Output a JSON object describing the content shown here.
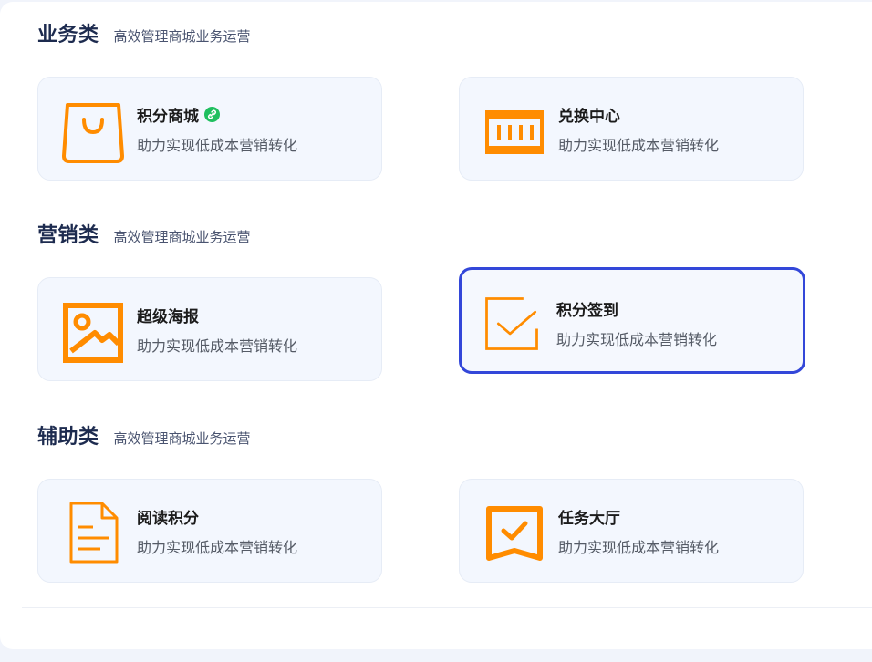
{
  "sections": [
    {
      "name": "业务类",
      "subtitle": "高效管理商城业务运营",
      "cards": [
        {
          "title": "积分商城",
          "desc": "助力实现低成本营销转化",
          "icon": "shopping-bag-icon",
          "badge": "link-icon"
        },
        {
          "title": "兑换中心",
          "desc": "助力实现低成本营销转化",
          "icon": "barcode-icon"
        }
      ]
    },
    {
      "name": "营销类",
      "subtitle": "高效管理商城业务运营",
      "cards": [
        {
          "title": "超级海报",
          "desc": "助力实现低成本营销转化",
          "icon": "image-icon"
        },
        {
          "title": "积分签到",
          "desc": "助力实现低成本营销转化",
          "icon": "checkbox-icon",
          "selected": true
        }
      ]
    },
    {
      "name": "辅助类",
      "subtitle": "高效管理商城业务运营",
      "cards": [
        {
          "title": "阅读积分",
          "desc": "助力实现低成本营销转化",
          "icon": "document-icon"
        },
        {
          "title": "任务大厅",
          "desc": "助力实现低成本营销转化",
          "icon": "task-banner-icon"
        }
      ]
    }
  ],
  "colors": {
    "icon_orange": "#ff8c00",
    "selected_border": "#3347d9",
    "badge_green": "#1fbf5f",
    "card_bg": "#f3f7fe",
    "heading": "#1d2b4f"
  }
}
